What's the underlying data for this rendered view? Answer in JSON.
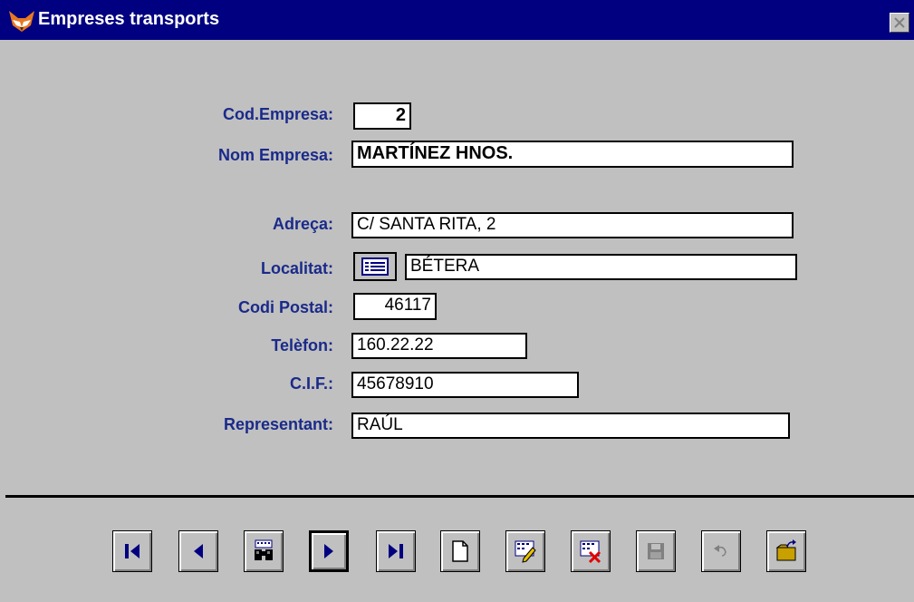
{
  "window": {
    "title": "Empreses transports"
  },
  "form": {
    "cod_empresa": {
      "label": "Cod.Empresa:",
      "value": "2"
    },
    "nom_empresa": {
      "label": "Nom Empresa:",
      "value": "MARTÍNEZ HNOS."
    },
    "adreca": {
      "label": "Adreça:",
      "value": "C/ SANTA RITA, 2"
    },
    "localitat": {
      "label": "Localitat:",
      "value": "BÉTERA"
    },
    "codi_postal": {
      "label": "Codi Postal:",
      "value": "46117"
    },
    "telefon": {
      "label": "Telèfon:",
      "value": "160.22.22"
    },
    "cif": {
      "label": "C.I.F.:",
      "value": "45678910"
    },
    "representant": {
      "label": "Representant:",
      "value": "RAÚL"
    }
  },
  "toolbar": {
    "buttons": [
      {
        "icon": "first-record-icon",
        "enabled": true
      },
      {
        "icon": "previous-record-icon",
        "enabled": true
      },
      {
        "icon": "find-binoculars-icon",
        "enabled": true
      },
      {
        "icon": "next-record-icon",
        "enabled": true,
        "active": true
      },
      {
        "icon": "last-record-icon",
        "enabled": true
      },
      {
        "icon": "new-document-icon",
        "enabled": true
      },
      {
        "icon": "edit-record-icon",
        "enabled": true
      },
      {
        "icon": "delete-record-icon",
        "enabled": true
      },
      {
        "icon": "save-disk-icon",
        "enabled": false
      },
      {
        "icon": "undo-icon",
        "enabled": false
      },
      {
        "icon": "exit-folder-icon",
        "enabled": true
      }
    ]
  },
  "colors": {
    "titlebar": "#000080",
    "label": "#1a2a8a",
    "face": "#c0c0c0"
  }
}
